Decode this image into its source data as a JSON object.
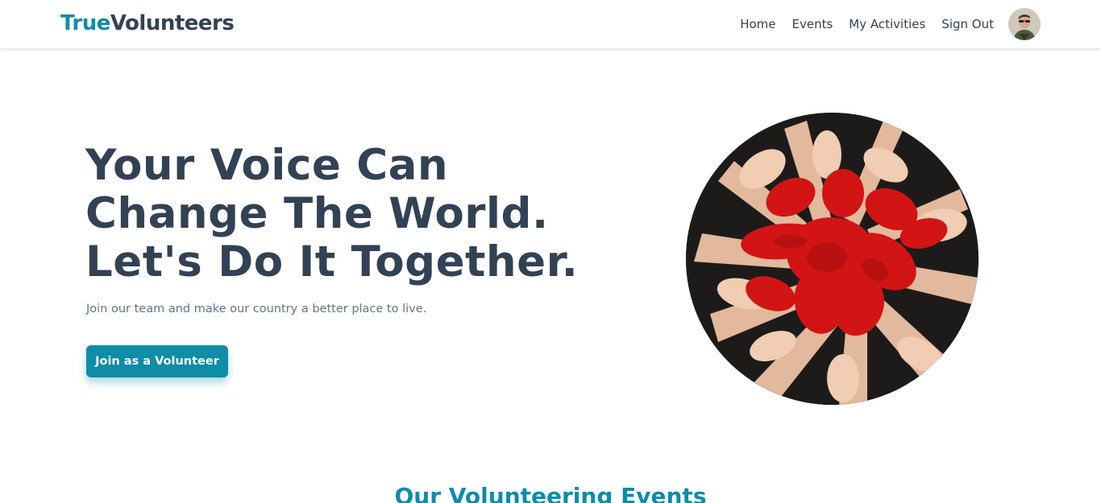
{
  "brand": {
    "accent": "True",
    "rest": "Volunteers"
  },
  "nav": {
    "home": "Home",
    "events": "Events",
    "my_activities": "My Activities",
    "sign_out": "Sign Out"
  },
  "hero": {
    "title_lines": [
      "Your Voice Can",
      "Change The World.",
      "Let's Do It Together."
    ],
    "subtitle": "Join our team and make our country a better place to live.",
    "cta_label": "Join as a Volunteer",
    "image": "hands-painted-red-heart-photo"
  },
  "events_section": {
    "title": "Our Volunteering Events"
  },
  "colors": {
    "accent": "#0e8ca8",
    "heading": "#334155",
    "muted": "#64748b",
    "paint_red": "#d21414"
  },
  "icons": {
    "avatar": "user-avatar"
  }
}
